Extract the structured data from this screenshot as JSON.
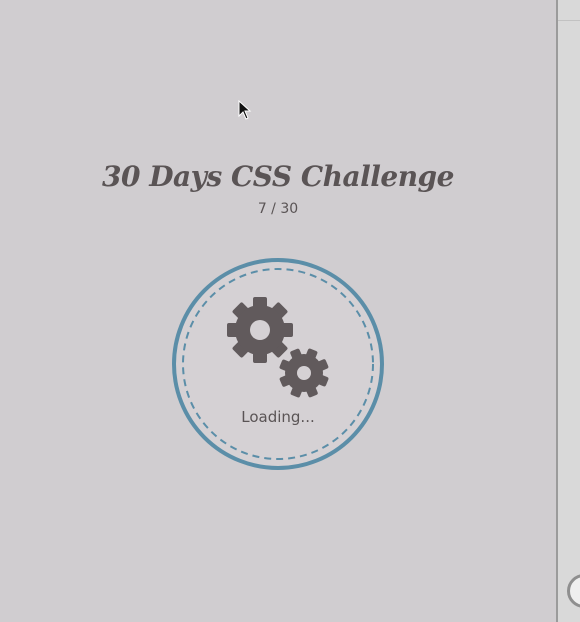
{
  "header": {
    "title": "30 Days CSS Challenge",
    "counter": "7 / 30"
  },
  "loader": {
    "label": "Loading...",
    "icons": [
      "large-gear-icon",
      "small-gear-icon"
    ]
  },
  "colors": {
    "background": "#d0cdd0",
    "text": "#5a5455",
    "ring": "#5b8ea8",
    "gear": "#615a5c"
  }
}
